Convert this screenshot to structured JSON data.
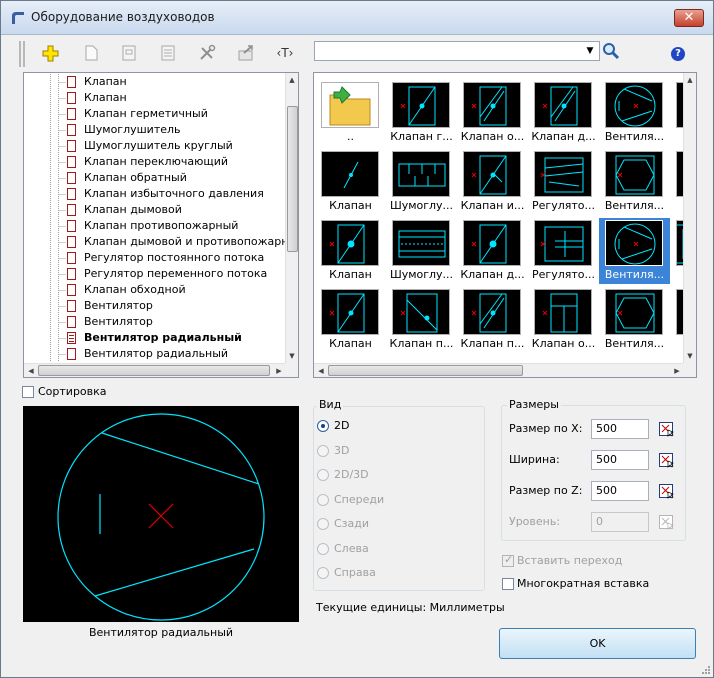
{
  "window": {
    "title": "Оборудование воздуховодов",
    "close_glyph": "✕"
  },
  "toolbar": {
    "buttons": [
      "add-icon",
      "new-document-icon",
      "properties-icon",
      "list-icon",
      "tools-icon",
      "export-icon",
      "text-style-icon"
    ],
    "text_btn": "‹T›"
  },
  "search": {
    "value": "",
    "dropdown_glyph": "▼"
  },
  "help": {
    "label": "?"
  },
  "tree": {
    "items": [
      {
        "label": "Клапан",
        "bold": false
      },
      {
        "label": "Клапан",
        "bold": false
      },
      {
        "label": "Клапан герметичный",
        "bold": false
      },
      {
        "label": "Шумоглушитель",
        "bold": false
      },
      {
        "label": "Шумоглушитель круглый",
        "bold": false
      },
      {
        "label": "Клапан переключающий",
        "bold": false
      },
      {
        "label": "Клапан обратный",
        "bold": false
      },
      {
        "label": "Клапан избыточного давления",
        "bold": false
      },
      {
        "label": "Клапан дымовой",
        "bold": false
      },
      {
        "label": "Клапан противопожарный",
        "bold": false
      },
      {
        "label": "Клапан дымовой и противопожарный",
        "bold": false
      },
      {
        "label": "Регулятор постоянного потока",
        "bold": false
      },
      {
        "label": "Регулятор переменного потока",
        "bold": false
      },
      {
        "label": "Клапан обходной",
        "bold": false
      },
      {
        "label": "Вентилятор",
        "bold": false
      },
      {
        "label": "Вентилятор",
        "bold": false
      },
      {
        "label": "Вентилятор радиальный",
        "bold": true
      },
      {
        "label": "Вентилятор радиальный",
        "bold": false
      }
    ]
  },
  "thumbnails": [
    [
      "..",
      "Клапан г...",
      "Клапан о...",
      "Клапан д...",
      "Вентиля...",
      "Вен"
    ],
    [
      "Клапан",
      "Шумоглу...",
      "Клапан и...",
      "Регулято...",
      "Вентиля...",
      "Вен"
    ],
    [
      "Клапан",
      "Шумоглу...",
      "Клапан д...",
      "Регулято...",
      "Вентиля...",
      "Фил"
    ],
    [
      "Клапан",
      "Клапан п...",
      "Клапан п...",
      "Клапан о...",
      "Вентиля...",
      "Кла"
    ]
  ],
  "sort": {
    "label": "Сортировка",
    "checked": false
  },
  "preview": {
    "caption": "Вентилятор радиальный"
  },
  "view": {
    "title": "Вид",
    "options": [
      {
        "label": "2D",
        "selected": true,
        "enabled": true
      },
      {
        "label": "3D",
        "selected": false,
        "enabled": false
      },
      {
        "label": "2D/3D",
        "selected": false,
        "enabled": false
      },
      {
        "label": "Спереди",
        "selected": false,
        "enabled": false
      },
      {
        "label": "Сзади",
        "selected": false,
        "enabled": false
      },
      {
        "label": "Слева",
        "selected": false,
        "enabled": false
      },
      {
        "label": "Справа",
        "selected": false,
        "enabled": false
      }
    ]
  },
  "sizes": {
    "title": "Размеры",
    "fields": [
      {
        "label": "Размер по X:",
        "value": "500",
        "enabled": true
      },
      {
        "label": "Ширина:",
        "value": "500",
        "enabled": true
      },
      {
        "label": "Размер по Z:",
        "value": "500",
        "enabled": true
      },
      {
        "label": "Уровень:",
        "value": "0",
        "enabled": false
      }
    ]
  },
  "insert_transition": {
    "label": "Вставить переход",
    "checked": true,
    "enabled": false
  },
  "multi_insert": {
    "label": "Многократная вставка",
    "checked": false
  },
  "units": {
    "label": "Текущие единицы: Миллиметры"
  },
  "ok": {
    "label": "OK"
  },
  "colors": {
    "cad_line": "#00e5ff",
    "cad_mark": "#e00000",
    "selection": "#3b84d8"
  }
}
